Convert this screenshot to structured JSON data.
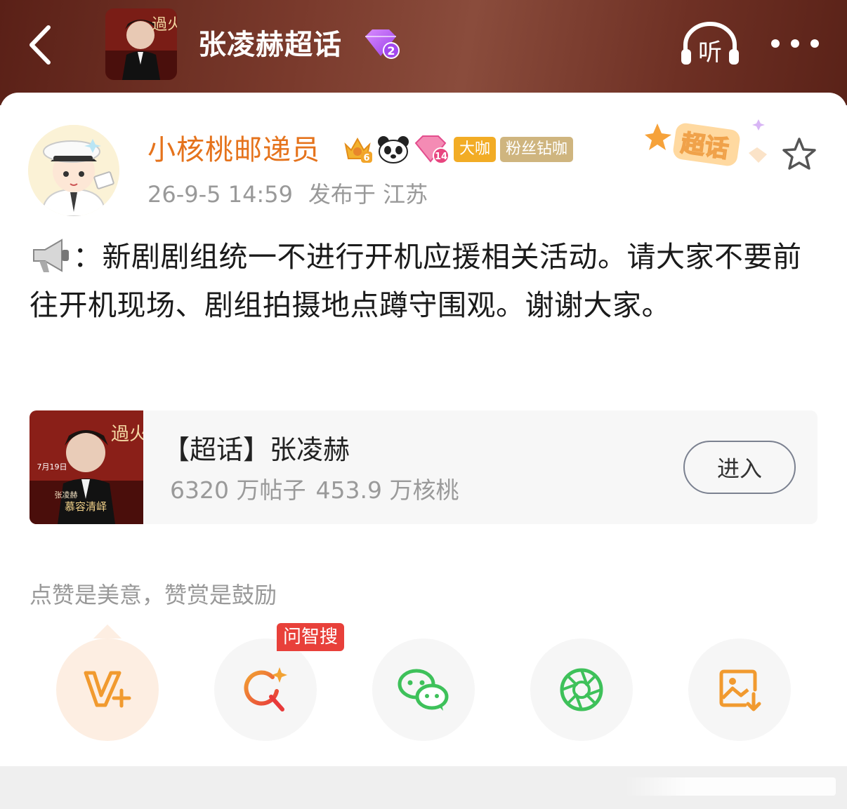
{
  "header": {
    "back_icon": "chevron-left-icon",
    "title": "张凌赫超话",
    "level_badge": "2",
    "listen_label": "听",
    "more_icon": "more-dots-icon"
  },
  "post": {
    "author": "小核桃邮递员",
    "crown_level": "6",
    "gem_level": "14",
    "tags": [
      "大咖",
      "粉丝钻咖"
    ],
    "time": "26-9-5 14:59",
    "location": "发布于 江苏",
    "supertopic_tag": "超话",
    "text": "：新剧剧组统一不进行开机应援相关活动。请大家不要前往开机现场、剧组拍摄地点蹲守围观。谢谢大家。"
  },
  "topic_card": {
    "title": "【超话】张凌赫",
    "posts": "6320 万帖子",
    "members": "453.9 万核桃",
    "button": "进入",
    "poster_text": {
      "date": "7月19日",
      "name": "张凌赫",
      "role": "慕容清峄",
      "drama": "過火"
    }
  },
  "reward_hint": "点赞是美意，赞赏是鼓励",
  "share_actions": [
    {
      "name": "reward-v-plus",
      "icon": "v-plus-icon"
    },
    {
      "name": "ai-search",
      "icon": "ai-search-icon",
      "badge": "问智搜"
    },
    {
      "name": "wechat",
      "icon": "wechat-icon"
    },
    {
      "name": "moments",
      "icon": "moments-aperture-icon"
    },
    {
      "name": "save-image",
      "icon": "save-image-icon"
    }
  ],
  "colors": {
    "username": "#e5731c",
    "header_bg": "#6e3024",
    "tag_orange": "#f2ac25",
    "tag_gold": "#cfb57f",
    "ai_badge": "#e8403a",
    "wechat_green": "#3ec15a",
    "icon_orange": "#f19a2f"
  }
}
